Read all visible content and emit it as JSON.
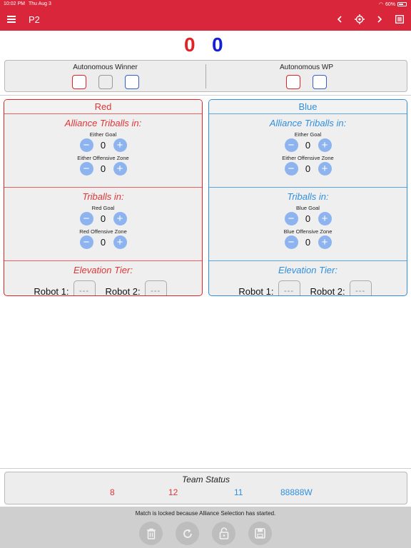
{
  "status_bar": {
    "time": "10:02 PM",
    "date": "Thu Aug 3",
    "battery": "60%"
  },
  "app_bar": {
    "title": "P2"
  },
  "score": {
    "red": "0",
    "blue": "0"
  },
  "autonomous": {
    "winner_label": "Autonomous Winner",
    "wp_label": "Autonomous WP"
  },
  "red": {
    "header": "Red",
    "triballs_title": "Alliance Triballs in:",
    "goal_label": "Either Goal",
    "goal_value": "0",
    "zone_label": "Either Offensive Zone",
    "zone_value": "0",
    "own_title": "Triballs in:",
    "own_goal_label": "Red Goal",
    "own_goal_value": "0",
    "own_zone_label": "Red Offensive Zone",
    "own_zone_value": "0",
    "elevation_title": "Elevation Tier:",
    "robot1_label": "Robot 1:",
    "robot1_value": "---",
    "robot2_label": "Robot 2:",
    "robot2_value": "---"
  },
  "blue": {
    "header": "Blue",
    "triballs_title": "Alliance Triballs in:",
    "goal_label": "Either Goal",
    "goal_value": "0",
    "zone_label": "Either Offensive Zone",
    "zone_value": "0",
    "own_title": "Triballs in:",
    "own_goal_label": "Blue Goal",
    "own_goal_value": "0",
    "own_zone_label": "Blue Offensive Zone",
    "own_zone_value": "0",
    "elevation_title": "Elevation Tier:",
    "robot1_label": "Robot 1:",
    "robot1_value": "---",
    "robot2_label": "Robot 2:",
    "robot2_value": "---"
  },
  "team_status": {
    "title": "Team Status",
    "teams": [
      "8",
      "12",
      "11",
      "88888W"
    ]
  },
  "bottom": {
    "lock_message": "Match is locked because Alliance Selection has started."
  },
  "icons": {
    "menu": "menu-icon",
    "prev": "chevron-left-icon",
    "locate": "crosshair-icon",
    "next": "chevron-right-icon",
    "list": "list-icon",
    "delete": "trash-icon",
    "refresh": "refresh-icon",
    "unlock": "unlock-icon",
    "save": "save-icon"
  },
  "colors": {
    "app_bar": "#d9263a",
    "red": "#e02424",
    "blue": "#1420d6",
    "stepper": "#8eb4f0"
  }
}
